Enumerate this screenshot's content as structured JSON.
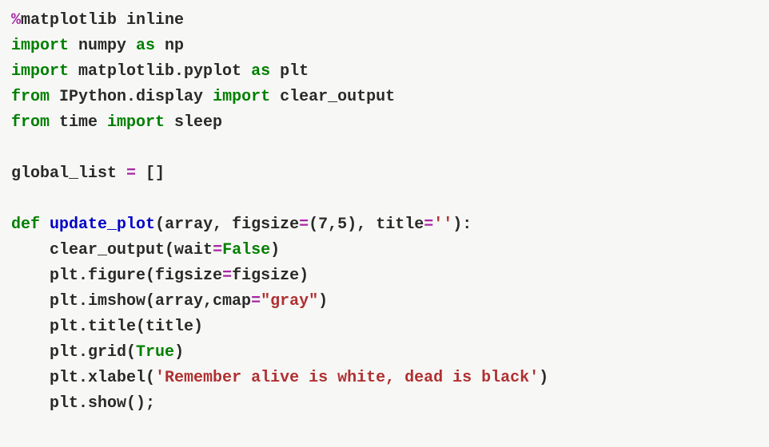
{
  "code": {
    "l0": {
      "magic_pct": "%",
      "magic_rest": "matplotlib inline"
    },
    "l1": {
      "import": "import",
      "mod": " numpy ",
      "as": "as",
      "alias": " np"
    },
    "l2": {
      "import": "import",
      "mod": " matplotlib.pyplot ",
      "as": "as",
      "alias": " plt"
    },
    "l3": {
      "from": "from",
      "mod": " IPython.display ",
      "import": "import",
      "name": " clear_output"
    },
    "l4": {
      "from": "from",
      "mod": " time ",
      "import": "import",
      "name": " sleep"
    },
    "l5": {
      "blank": " "
    },
    "l6": {
      "text1": "global_list ",
      "eq": "=",
      "text2": " []"
    },
    "l7": {
      "blank": " "
    },
    "l8": {
      "def": "def",
      "sp1": " ",
      "fname": "update_plot",
      "open": "(",
      "p1": "array, figsize",
      "eq1": "=",
      "p2": "(",
      "n1": "7",
      "comma1": ",",
      "n2": "5",
      "p3": "), title",
      "eq2": "=",
      "str1": "''",
      "close": "):"
    },
    "l9": {
      "indent": "    ",
      "call": "clear_output(wait",
      "eq": "=",
      "bool": "False",
      "close": ")"
    },
    "l10": {
      "indent": "    ",
      "call1": "plt.figure(figsize",
      "eq": "=",
      "call2": "figsize)"
    },
    "l11": {
      "indent": "    ",
      "call1": "plt.imshow(array,cmap",
      "eq": "=",
      "str": "\"gray\"",
      "close": ")"
    },
    "l12": {
      "indent": "    ",
      "call": "plt.title(title)"
    },
    "l13": {
      "indent": "    ",
      "call1": "plt.grid(",
      "bool": "True",
      "close": ")"
    },
    "l14": {
      "indent": "    ",
      "call1": "plt.xlabel(",
      "str": "'Remember alive is white, dead is black'",
      "close": ")"
    },
    "l15": {
      "indent": "    ",
      "call": "plt.show();"
    }
  }
}
